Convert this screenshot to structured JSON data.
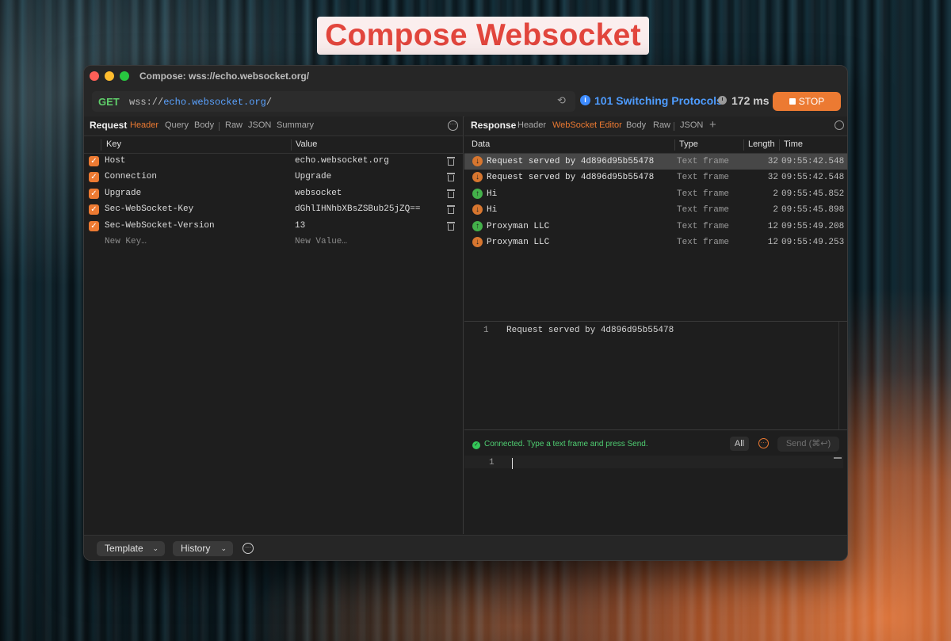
{
  "banner": {
    "title": "Compose Websocket"
  },
  "window": {
    "title": "Compose: wss://echo.websocket.org/"
  },
  "urlbar": {
    "method": "GET",
    "scheme": "wss://",
    "host": "echo.websocket.org",
    "path": "/",
    "status": "101 Switching Protocols",
    "duration": "172 ms",
    "stop_label": "STOP"
  },
  "request": {
    "section_label": "Request",
    "tabs": [
      "Header",
      "Query",
      "Body",
      "Raw",
      "JSON",
      "Summary"
    ],
    "active_tab": "Header",
    "columns": {
      "key": "Key",
      "value": "Value"
    },
    "headers": [
      {
        "key": "Host",
        "value": "echo.websocket.org",
        "checked": true
      },
      {
        "key": "Connection",
        "value": "Upgrade",
        "checked": true
      },
      {
        "key": "Upgrade",
        "value": "websocket",
        "checked": true
      },
      {
        "key": "Sec-WebSocket-Key",
        "value": "dGhlIHNhbXBsZSBub25jZQ==",
        "checked": true
      },
      {
        "key": "Sec-WebSocket-Version",
        "value": "13",
        "checked": true
      }
    ],
    "new_key_placeholder": "New Key…",
    "new_value_placeholder": "New Value…"
  },
  "response": {
    "section_label": "Response",
    "tabs": [
      "Header",
      "WebSocket Editor",
      "Body",
      "Raw",
      "JSON"
    ],
    "active_tab": "WebSocket Editor",
    "columns": {
      "data": "Data",
      "type": "Type",
      "length": "Length",
      "time": "Time"
    },
    "frames": [
      {
        "direction": "in",
        "data": "Request served by 4d896d95b55478",
        "type": "Text frame",
        "length": "32",
        "time": "09:55:42.548",
        "selected": true
      },
      {
        "direction": "in",
        "data": "Request served by 4d896d95b55478",
        "type": "Text frame",
        "length": "32",
        "time": "09:55:42.548"
      },
      {
        "direction": "out",
        "data": "Hi",
        "type": "Text frame",
        "length": "2",
        "time": "09:55:45.852"
      },
      {
        "direction": "in",
        "data": "Hi",
        "type": "Text frame",
        "length": "2",
        "time": "09:55:45.898"
      },
      {
        "direction": "out",
        "data": "Proxyman LLC",
        "type": "Text frame",
        "length": "12",
        "time": "09:55:49.208"
      },
      {
        "direction": "in",
        "data": "Proxyman LLC",
        "type": "Text frame",
        "length": "12",
        "time": "09:55:49.253"
      }
    ],
    "preview": {
      "line_number": "1",
      "text": "Request served by 4d896d95b55478"
    }
  },
  "composer": {
    "status": "Connected. Type a text frame and press Send.",
    "all_label": "All",
    "send_label": "Send (⌘↩)",
    "line_number": "1"
  },
  "bottom": {
    "template_label": "Template",
    "history_label": "History"
  },
  "colors": {
    "accent": "#ec7a32",
    "link": "#4e9cff",
    "success": "#34c759",
    "method": "#5fce6a",
    "banner_text": "#e2463d"
  }
}
